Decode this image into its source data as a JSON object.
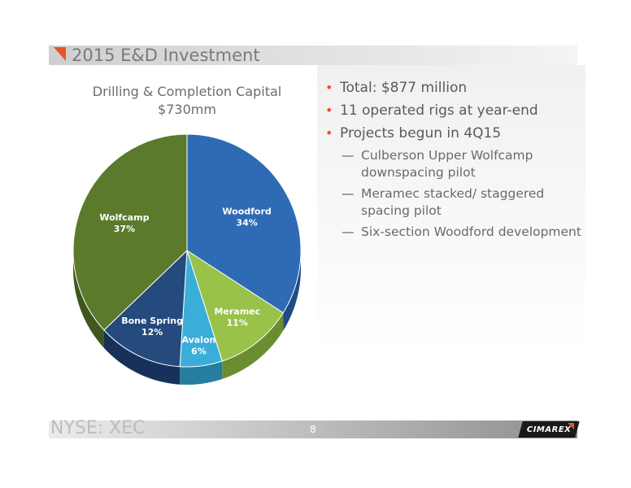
{
  "slide": {
    "title": "2015 E&D Investment",
    "footer_ticker": "NYSE: XEC",
    "page_number": "8",
    "logo_text": "CIMAREX"
  },
  "bullets": [
    {
      "text": "Total: $877 million"
    },
    {
      "text": "11 operated rigs at year-end"
    },
    {
      "text": "Projects begun in 4Q15"
    }
  ],
  "sub_bullets": [
    {
      "text": "Culberson Upper Wolfcamp downspacing pilot"
    },
    {
      "text": "Meramec stacked/ staggered spacing pilot"
    },
    {
      "text": "Six-section Woodford development"
    }
  ],
  "colors": {
    "accent": "#e8542a",
    "woodford": "#2f6bb5",
    "meramec": "#98c24a",
    "avalon": "#3aaed8",
    "bone_spring": "#244a7e",
    "wolfcamp": "#5c7a2c"
  },
  "chart_data": {
    "type": "pie",
    "title_lines": [
      "Drilling & Completion Capital",
      "$730mm"
    ],
    "slices": [
      {
        "name": "Woodford",
        "value": 34,
        "pct_label": "34%",
        "color": "#2f6bb5",
        "side": "#1f4c85"
      },
      {
        "name": "Meramec",
        "value": 11,
        "pct_label": "11%",
        "color": "#98c24a",
        "side": "#6c8c30"
      },
      {
        "name": "Avalon",
        "value": 6,
        "pct_label": "6%",
        "color": "#3aaed8",
        "side": "#267e9e"
      },
      {
        "name": "Bone Spring",
        "value": 12,
        "pct_label": "12%",
        "color": "#244a7e",
        "side": "#17315a"
      },
      {
        "name": "Wolfcamp",
        "value": 37,
        "pct_label": "37%",
        "color": "#5c7a2c",
        "side": "#3f561c"
      }
    ]
  }
}
